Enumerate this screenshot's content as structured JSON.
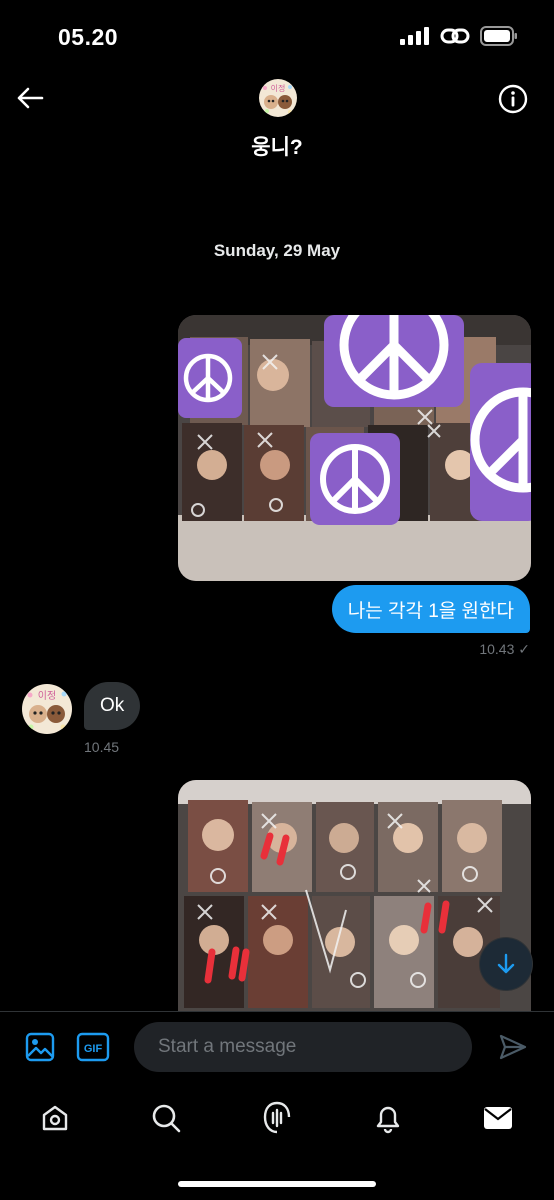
{
  "status_bar": {
    "time": "05.20"
  },
  "header": {
    "name": "웅니?",
    "avatar_text": "이정"
  },
  "conversation": {
    "date_separator": "Sunday, 29 May",
    "messages": [
      {
        "type": "image",
        "direction": "outgoing"
      },
      {
        "type": "text",
        "direction": "outgoing",
        "text": "나는 각각 1을 원한다",
        "time": "10.43 ✓"
      },
      {
        "type": "text",
        "direction": "incoming",
        "text": "Ok",
        "time": "10.45"
      },
      {
        "type": "image",
        "direction": "outgoing"
      }
    ]
  },
  "composer": {
    "placeholder": "Start a message",
    "gif_label": "GIF"
  },
  "tabbar": {
    "items": [
      "home-icon",
      "search-icon",
      "spaces-icon",
      "notifications-icon",
      "messages-icon"
    ]
  },
  "colors": {
    "accent": "#1d9bf0",
    "bubble_in": "#2f3336",
    "muted": "#71767b",
    "peace_purple": "#8a5fc9"
  }
}
